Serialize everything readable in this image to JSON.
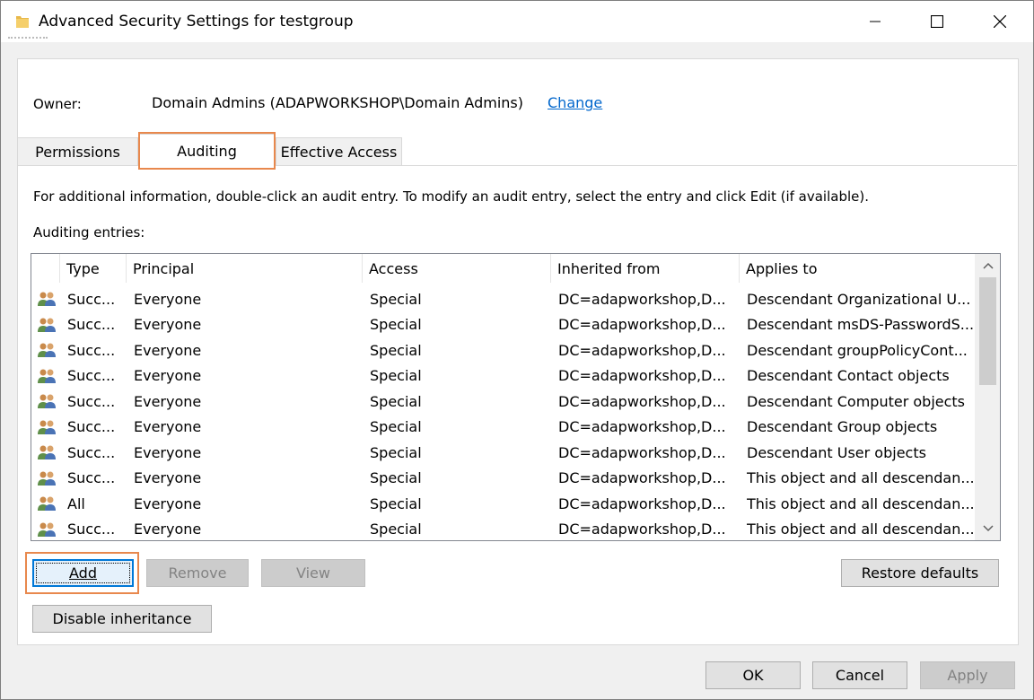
{
  "window": {
    "title": "Advanced Security Settings for testgroup",
    "icon": "folder-icon",
    "controls": [
      "minimize-icon",
      "maximize-icon",
      "close-icon"
    ]
  },
  "owner": {
    "label": "Owner:",
    "value": "Domain Admins (ADAPWORKSHOP\\Domain Admins)",
    "change_link": "Change"
  },
  "tabs": [
    {
      "label": "Permissions",
      "active": false
    },
    {
      "label": "Auditing",
      "active": true
    },
    {
      "label": "Effective Access",
      "active": false
    }
  ],
  "auditing": {
    "info_text": "For additional information, double-click an audit entry. To modify an audit entry, select the entry and click Edit (if available).",
    "entries_label": "Auditing entries:",
    "columns": [
      "Type",
      "Principal",
      "Access",
      "Inherited from",
      "Applies to"
    ],
    "rows": [
      {
        "type": "Succ...",
        "principal": "Everyone",
        "access": "Special",
        "inherited": "DC=adapworkshop,D...",
        "applies": "Descendant Organizational U..."
      },
      {
        "type": "Succ...",
        "principal": "Everyone",
        "access": "Special",
        "inherited": "DC=adapworkshop,D...",
        "applies": "Descendant msDS-PasswordS..."
      },
      {
        "type": "Succ...",
        "principal": "Everyone",
        "access": "Special",
        "inherited": "DC=adapworkshop,D...",
        "applies": "Descendant groupPolicyCont..."
      },
      {
        "type": "Succ...",
        "principal": "Everyone",
        "access": "Special",
        "inherited": "DC=adapworkshop,D...",
        "applies": "Descendant Contact objects"
      },
      {
        "type": "Succ...",
        "principal": "Everyone",
        "access": "Special",
        "inherited": "DC=adapworkshop,D...",
        "applies": "Descendant Computer objects"
      },
      {
        "type": "Succ...",
        "principal": "Everyone",
        "access": "Special",
        "inherited": "DC=adapworkshop,D...",
        "applies": "Descendant Group objects"
      },
      {
        "type": "Succ...",
        "principal": "Everyone",
        "access": "Special",
        "inherited": "DC=adapworkshop,D...",
        "applies": "Descendant User objects"
      },
      {
        "type": "Succ...",
        "principal": "Everyone",
        "access": "Special",
        "inherited": "DC=adapworkshop,D...",
        "applies": "This object and all descendan..."
      },
      {
        "type": "All",
        "principal": "Everyone",
        "access": "Special",
        "inherited": "DC=adapworkshop,D...",
        "applies": "This object and all descendan..."
      },
      {
        "type": "Succ...",
        "principal": "Everyone",
        "access": "Special",
        "inherited": "DC=adapworkshop,D...",
        "applies": "This object and all descendan..."
      }
    ]
  },
  "buttons": {
    "add": "Add",
    "remove": "Remove",
    "view": "View",
    "restore_defaults": "Restore defaults",
    "disable_inheritance": "Disable inheritance",
    "ok": "OK",
    "cancel": "Cancel",
    "apply": "Apply"
  },
  "colors": {
    "highlight": "#e8884d",
    "link": "#0066cc",
    "focus": "#0078d7"
  }
}
